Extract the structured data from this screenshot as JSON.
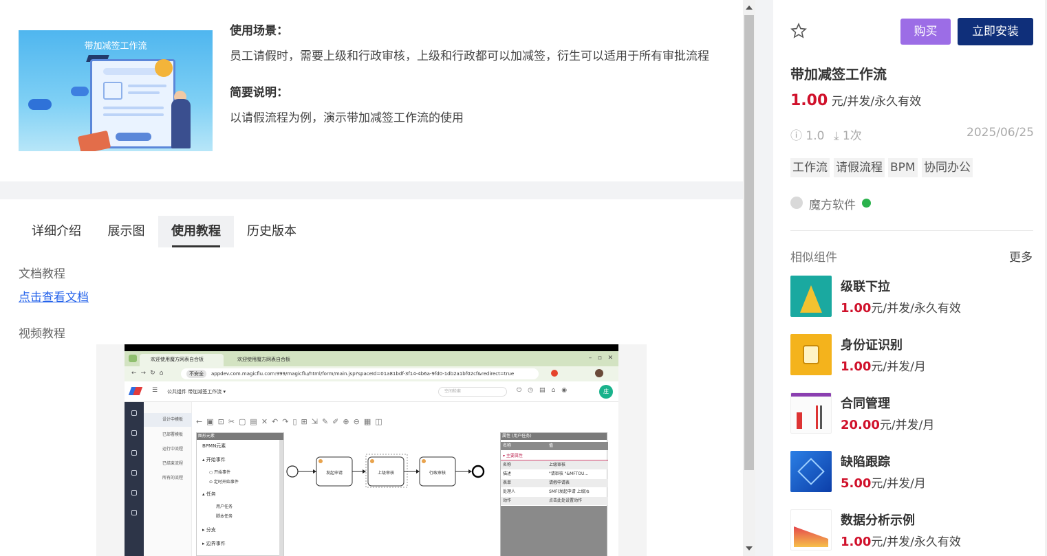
{
  "product": {
    "thumbnail_title": "带加减签工作流",
    "usage_heading": "使用场景：",
    "usage_text": "员工请假时，需要上级和行政审核，上级和行政都可以加减签，衍生可以适用于所有审批流程",
    "brief_heading": "简要说明：",
    "brief_text": "以请假流程为例，演示带加减签工作流的使用"
  },
  "tabs": [
    {
      "label": "详细介绍",
      "active": false
    },
    {
      "label": "展示图",
      "active": false
    },
    {
      "label": "使用教程",
      "active": true
    },
    {
      "label": "历史版本",
      "active": false
    }
  ],
  "tutorial": {
    "doc_heading": "文档教程",
    "doc_link": "点击查看文档",
    "video_heading": "视频教程"
  },
  "video_frame": {
    "browser_tab_1": "欢迎使用魔方网表自合板",
    "browser_tab_2": "欢迎使用魔方网表自合板",
    "insecure_label": "不安全",
    "url": "appdev.com.magicflu.com:999/magicflu/html/form/main.jsp?spaceId=01a81bdf-3f14-4b6a-9fd0-1db2a1bf02cf&redirect=true",
    "breadcrumb": "公共组件  带加减签工作流 ▾",
    "search_placeholder": "空间检索",
    "avatar_text": "庄",
    "nav_items": [
      "设计中模板",
      "已部署模板",
      "运行中流程",
      "已结束流程",
      "所有的流程"
    ],
    "palette_title": "图形元素",
    "palette_items": [
      "BPMN元素",
      "▴ 开始事件",
      "○ 开始事件",
      "⊙ 定时开始事件",
      "▴ 任务",
      "用户任务",
      "脚本任务",
      "▸ 分支",
      "▸ 边界事件"
    ],
    "flow_nodes": [
      "发起申请",
      "上级审核",
      "行政审核"
    ],
    "props_title": "属性 (用户任务)",
    "props_header": [
      "名称",
      "值"
    ],
    "props_section": "▾ 主要属性",
    "props_rows": [
      {
        "k": "名称",
        "v": "上级审核"
      },
      {
        "k": "描述",
        "v": "\"请审核 \"&MFTOU..."
      },
      {
        "k": "表单",
        "v": "请假申请表"
      },
      {
        "k": "处理人",
        "v": "SMF(发起申请 上级)$"
      },
      {
        "k": "动作",
        "v": "点击此处设置动作"
      }
    ]
  },
  "sidebar": {
    "buy_label": "购买",
    "install_label": "立即安装",
    "title": "带加减签工作流",
    "price_amount": "1.00",
    "price_unit": "元/并发/永久有效",
    "version": "1.0",
    "downloads": "1次",
    "date": "2025/06/25",
    "tags": [
      "工作流",
      "请假流程",
      "BPM",
      "协同办公"
    ],
    "author": "魔方软件",
    "similar_heading": "相似组件",
    "more_label": "更多",
    "similar": [
      {
        "name": "级联下拉",
        "price": "1.00",
        "unit": "元/并发/永久有效"
      },
      {
        "name": "身份证识别",
        "price": "1.00",
        "unit": "元/并发/月"
      },
      {
        "name": "合同管理",
        "price": "20.00",
        "unit": "元/并发/月"
      },
      {
        "name": "缺陷跟踪",
        "price": "5.00",
        "unit": "元/并发/月"
      },
      {
        "name": "数据分析示例",
        "price": "1.00",
        "unit": "元/并发/永久有效"
      }
    ]
  },
  "colors": {
    "accent_buy": "#9c6de6",
    "accent_install": "#0f2f7a",
    "price_red": "#d0112b",
    "link_blue": "#2563eb"
  }
}
